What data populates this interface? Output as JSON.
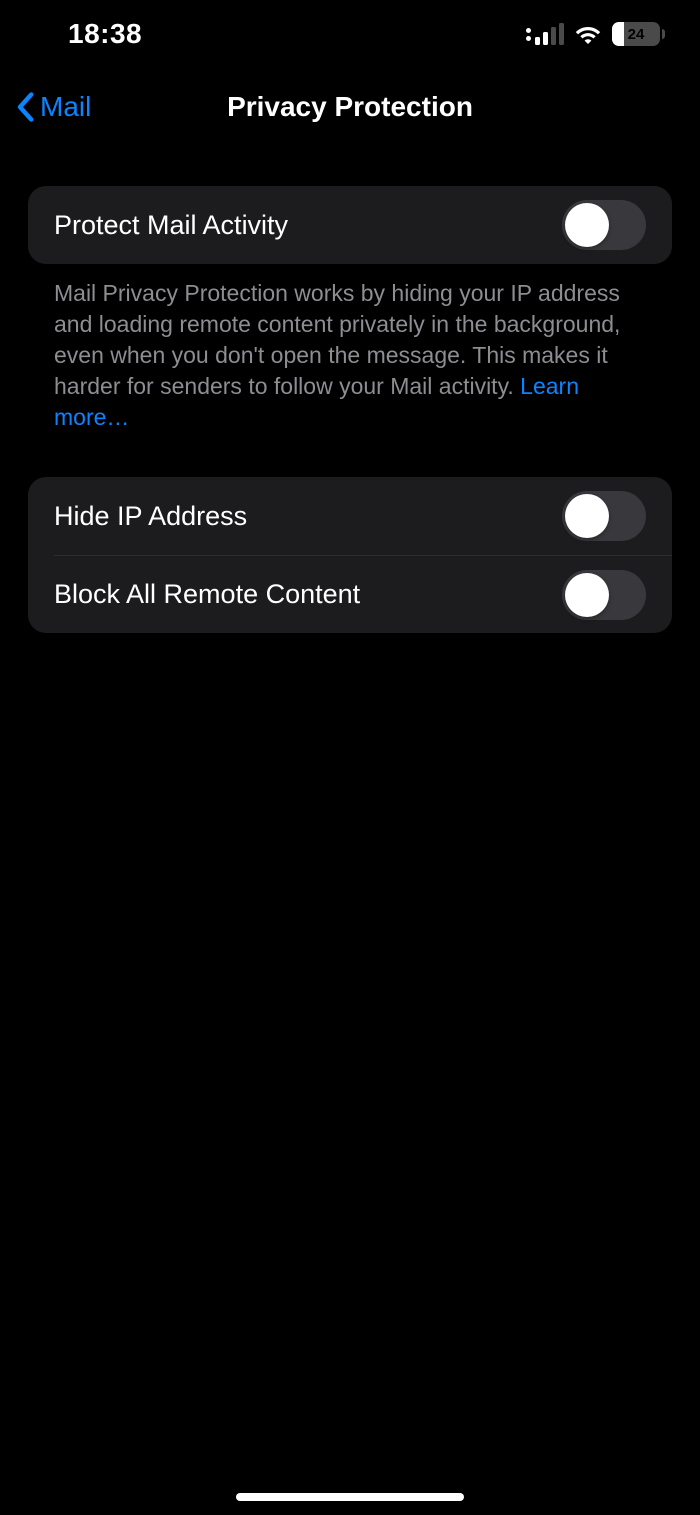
{
  "status": {
    "time": "18:38",
    "battery_percent": 24,
    "cellular_bars_active": 2,
    "cellular_bars_total": 4
  },
  "nav": {
    "back_label": "Mail",
    "title": "Privacy Protection"
  },
  "group1": {
    "items": [
      {
        "label": "Protect Mail Activity",
        "on": false
      }
    ],
    "footer_main": "Mail Privacy Protection works by hiding your IP address and loading remote content privately in the background, even when you don't open the message. This makes it harder for senders to follow your Mail activity. ",
    "footer_link": "Learn more…"
  },
  "group2": {
    "items": [
      {
        "label": "Hide IP Address",
        "on": false
      },
      {
        "label": "Block All Remote Content",
        "on": false
      }
    ]
  }
}
